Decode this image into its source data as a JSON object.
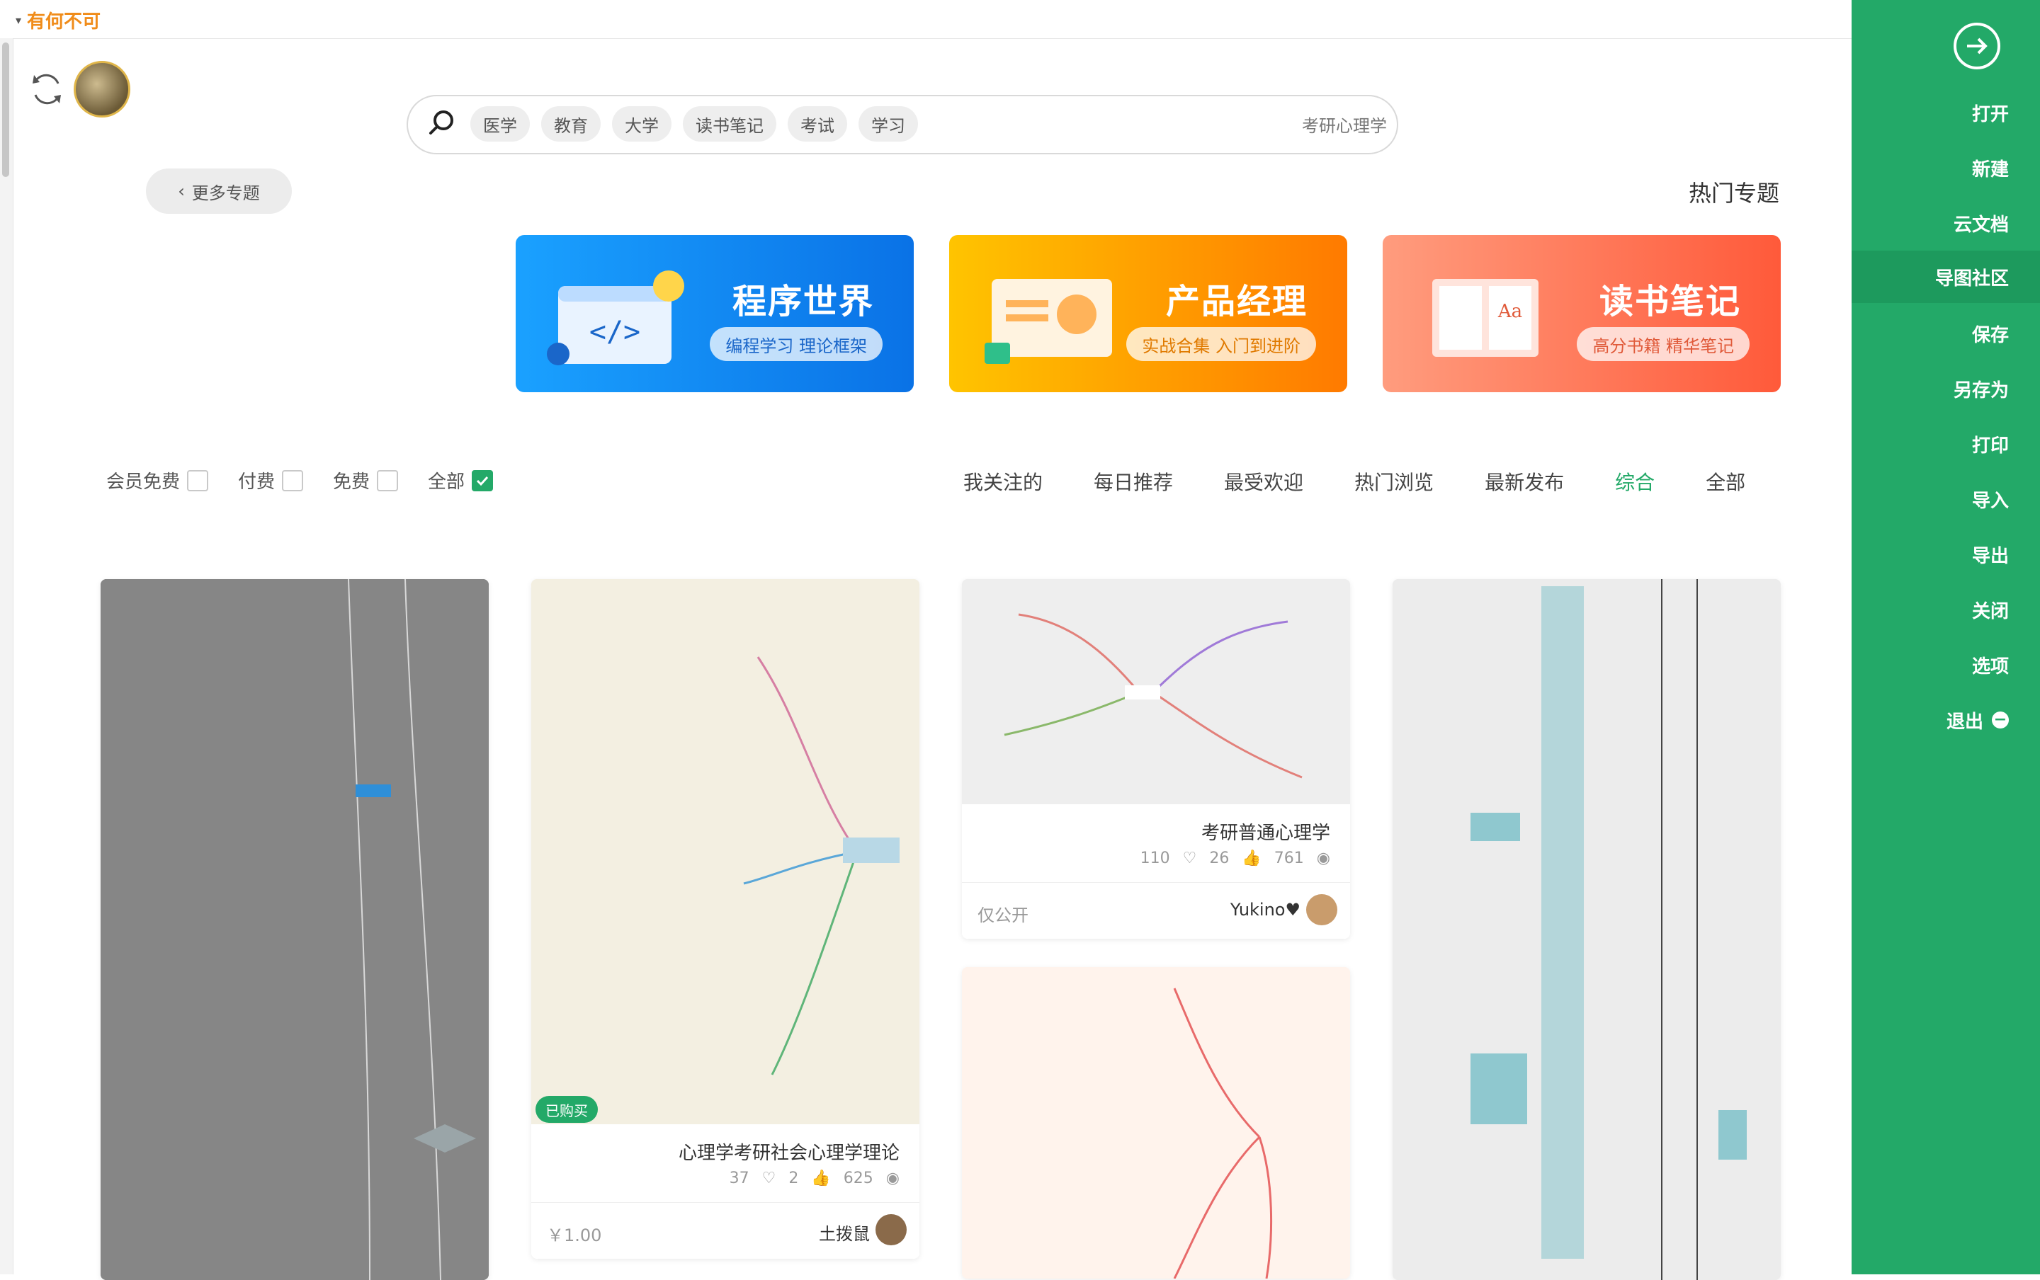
{
  "brand": {
    "name": "有何不可"
  },
  "sidebar": {
    "items": [
      {
        "label": "打开"
      },
      {
        "label": "新建"
      },
      {
        "label": "云文档"
      },
      {
        "label": "导图社区"
      },
      {
        "label": "保存"
      },
      {
        "label": "另存为"
      },
      {
        "label": "打印"
      },
      {
        "label": "导入"
      },
      {
        "label": "导出"
      },
      {
        "label": "关闭"
      },
      {
        "label": "选项"
      },
      {
        "label": "退出"
      }
    ],
    "active_index": 3,
    "accent": "#23a968"
  },
  "search": {
    "text": "考研心理学",
    "chips": [
      "学习",
      "考试",
      "读书笔记",
      "大学",
      "教育",
      "医学"
    ]
  },
  "hot": {
    "title": "热门专题",
    "more_label": "更多专题",
    "banners": [
      {
        "title": "读书笔记",
        "subtitle": "高分书籍 精华笔记"
      },
      {
        "title": "产品经理",
        "subtitle": "实战合集 入门到进阶"
      },
      {
        "title": "程序世界",
        "subtitle": "编程学习 理论框架"
      }
    ]
  },
  "tabs": [
    "全部",
    "综合",
    "最新发布",
    "热门浏览",
    "最受欢迎",
    "每日推荐",
    "我关注的"
  ],
  "active_tab": 1,
  "filters": [
    {
      "label": "全部",
      "checked": true
    },
    {
      "label": "免费",
      "checked": false
    },
    {
      "label": "付费",
      "checked": false
    },
    {
      "label": "会员免费",
      "checked": false
    }
  ],
  "cards": {
    "c2": {
      "title": "心理学考研社会心理学理论",
      "views": "625",
      "likes": "2",
      "favs": "37",
      "author": "土拨鼠",
      "price": "￥1.00",
      "badge": "已购买"
    },
    "c3": {
      "title": "考研普通心理学",
      "views": "761",
      "likes": "26",
      "favs": "110",
      "author": "Yukino♥",
      "price": "仅公开"
    }
  }
}
